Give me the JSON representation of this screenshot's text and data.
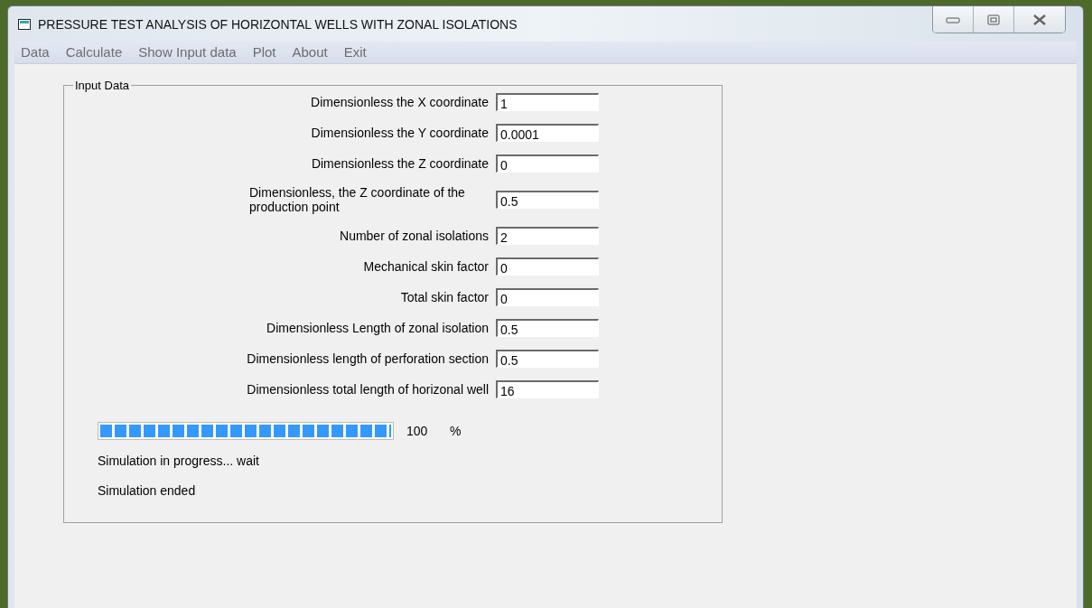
{
  "window": {
    "title": "PRESSURE TEST ANALYSIS OF HORIZONTAL WELLS WITH ZONAL ISOLATIONS"
  },
  "menu": [
    "Data",
    "Calculate",
    "Show Input data",
    "Plot",
    "About",
    "Exit"
  ],
  "group": {
    "title": "Input Data",
    "fields": [
      {
        "label": "Dimensionless the X coordinate",
        "value": "1"
      },
      {
        "label": "Dimensionless the Y coordinate",
        "value": "0.0001"
      },
      {
        "label": "Dimensionless the Z coordinate",
        "value": "0"
      },
      {
        "label": "Dimensionless, the Z coordinate of the production point",
        "value": "0.5"
      },
      {
        "label": "Number of zonal isolations",
        "value": "2"
      },
      {
        "label": "Mechanical skin factor",
        "value": "0"
      },
      {
        "label": "Total skin factor",
        "value": "0"
      },
      {
        "label": "Dimensionless Length of zonal isolation",
        "value": "0.5"
      },
      {
        "label": "Dimensionless length of perforation section",
        "value": "0.5"
      },
      {
        "label": "Dimensionless total length of horizonal well",
        "value": "16"
      }
    ],
    "progress": {
      "level": 1,
      "reading": "100",
      "unit": "%"
    },
    "messages": [
      "Simulation in progress... wait",
      "Simulation ended"
    ]
  }
}
